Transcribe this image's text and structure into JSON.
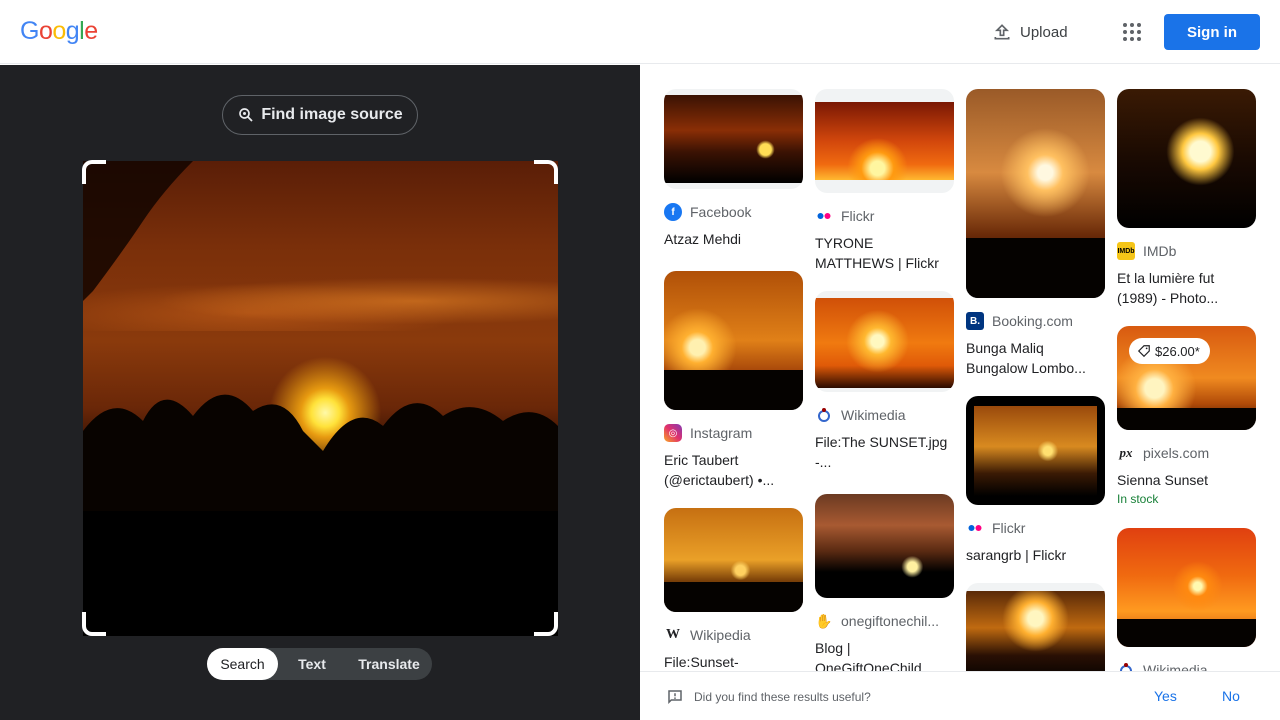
{
  "header": {
    "logo_letters": [
      {
        "ch": "G",
        "color": "#4285F4"
      },
      {
        "ch": "o",
        "color": "#EA4335"
      },
      {
        "ch": "o",
        "color": "#FBBC05"
      },
      {
        "ch": "g",
        "color": "#4285F4"
      },
      {
        "ch": "l",
        "color": "#34A853"
      },
      {
        "ch": "e",
        "color": "#EA4335"
      }
    ],
    "upload_label": "Upload",
    "apps_icon": "apps-grid-icon",
    "signin_label": "Sign in",
    "signin_color": "#1a73e8"
  },
  "left": {
    "find_source_label": "Find image source",
    "modes": [
      "Search",
      "Text",
      "Translate"
    ],
    "active_mode": "Search"
  },
  "results": [
    {
      "col": 0,
      "source": "Facebook",
      "source_icon": "facebook-icon",
      "title": "Atzaz Mehdi"
    },
    {
      "col": 0,
      "source": "Instagram",
      "source_icon": "instagram-icon",
      "title": "Eric Taubert (@erictaubert) •..."
    },
    {
      "col": 0,
      "source": "Wikipedia",
      "source_icon": "wikipedia-icon",
      "title": "File:Sunset-"
    },
    {
      "col": 1,
      "source": "Flickr",
      "source_icon": "flickr-icon",
      "title": "TYRONE MATTHEWS | Flickr"
    },
    {
      "col": 1,
      "source": "Wikimedia",
      "source_icon": "wikimedia-icon",
      "title": "File:The SUNSET.jpg -..."
    },
    {
      "col": 1,
      "source": "onegiftonechil...",
      "source_icon": "onegiftonechild-icon",
      "title": "Blog | OneGiftOneChild"
    },
    {
      "col": 2,
      "source": "Booking.com",
      "source_icon": "booking-icon",
      "title": "Bunga Maliq Bungalow Lombo..."
    },
    {
      "col": 2,
      "source": "Flickr",
      "source_icon": "flickr-icon",
      "title": "sarangrb | Flickr"
    },
    {
      "col": 3,
      "source": "IMDb",
      "source_icon": "imdb-icon",
      "title": "Et la lumière fut (1989) - Photo..."
    },
    {
      "col": 3,
      "source": "pixels.com",
      "source_icon": "pixels-icon",
      "title": "Sienna Sunset",
      "price": "$26.00*",
      "stock": "In stock"
    },
    {
      "col": 3,
      "source": "Wikimedia",
      "source_icon": "wikimedia-icon",
      "title": ""
    }
  ],
  "feedback": {
    "question": "Did you find these results useful?",
    "yes_label": "Yes",
    "no_label": "No"
  }
}
